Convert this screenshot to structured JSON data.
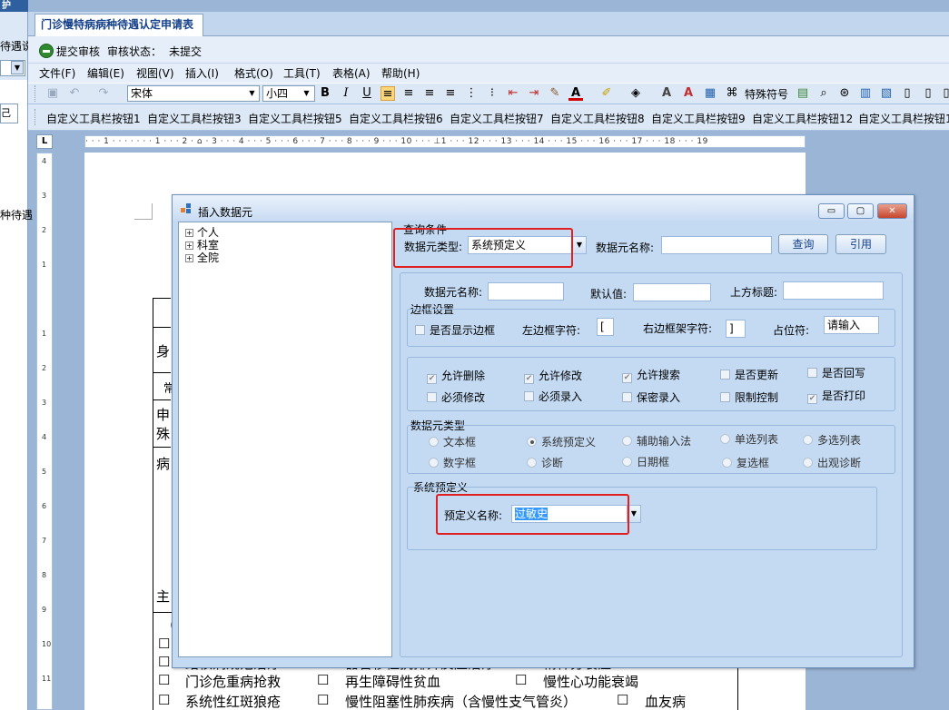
{
  "left_panel": {
    "tab_label": "护",
    "text1": "待遇说",
    "button_label": "己",
    "text2": "种待遇"
  },
  "document_tab": {
    "title": "门诊慢特病病种待遇认定申请表"
  },
  "status_bar": {
    "submit_label": "提交审核",
    "status_label": "审核状态：",
    "status_value": "未提交"
  },
  "menu": [
    "文件(F)",
    "编辑(E)",
    "视图(V)",
    "插入(I)",
    "格式(O)",
    "工具(T)",
    "表格(A)",
    "帮助(H)"
  ],
  "toolbar": {
    "font_name": "宋体",
    "font_size": "小四",
    "special_char_label": "特殊符号"
  },
  "custom_toolbar": [
    "自定义工具栏按钮1",
    "自定义工具栏按钮3",
    "自定义工具栏按钮5",
    "自定义工具栏按钮6",
    "自定义工具栏按钮7",
    "自定义工具栏按钮8",
    "自定义工具栏按钮9",
    "自定义工具栏按钮12",
    "自定义工具栏按钮1"
  ],
  "ruler": {
    "h_text": "· · · 1 · · ·   · · · · 1 · · · 2 · ⌂ · 3 · · · 4 · · · 5 · · · 6 · · · 7 · · · 8 · · · 9 · · · 10 · · · ⊥1 · · · 12 · · · 13 · · · 14 · · · 15 · · · 16 · · · 17 · · · 18 · · · 19",
    "v_numbers": [
      "4",
      "3",
      "2",
      "1",
      "1",
      "2",
      "3",
      "4",
      "5",
      "6",
      "7",
      "8",
      "9",
      "10",
      "11"
    ]
  },
  "document": {
    "fragments": [
      "身",
      "常",
      "申",
      "殊",
      "病",
      "主",
      "（"
    ],
    "rows": [
      [
        "☐",
        "结核病规范治疗",
        "☐",
        "器官移植抗排异反应治疗",
        "☐",
        "精神分裂症"
      ],
      [
        "☐",
        "门诊危重病抢救",
        "☐",
        "再生障碍性贫血",
        "☐",
        "慢性心功能衰竭"
      ],
      [
        "☐",
        "系统性红斑狼疮",
        "☐",
        "慢性阻塞性肺疾病（含慢性支气管炎）",
        "☐",
        "血友病"
      ]
    ]
  },
  "dialog": {
    "title": "插入数据元",
    "tree": [
      "个人",
      "科室",
      "全院"
    ],
    "query": {
      "group_title": "查询条件",
      "type_label": "数据元类型:",
      "type_value": "系统预定义",
      "name_label": "数据元名称:",
      "name_value": "",
      "search_button": "查询",
      "reference_button": "引用"
    },
    "props": {
      "name_label": "数据元名称:",
      "default_label": "默认值:",
      "top_title_label": "上方标题:",
      "border_group": "边框设置",
      "show_border": "是否显示边框",
      "left_border_label": "左边框字符:",
      "left_border_value": "[",
      "right_border_label": "右边框架字符:",
      "right_border_value": "]",
      "placeholder_label": "占位符:",
      "placeholder_value": "请输入"
    },
    "options": [
      {
        "label": "允许删除",
        "checked": true
      },
      {
        "label": "允许修改",
        "checked": true
      },
      {
        "label": "允许搜索",
        "checked": true
      },
      {
        "label": "是否更新",
        "checked": false
      },
      {
        "label": "是否回写",
        "checked": false
      },
      {
        "label": "必须修改",
        "checked": false
      },
      {
        "label": "必须录入",
        "checked": false
      },
      {
        "label": "保密录入",
        "checked": false
      },
      {
        "label": "限制控制",
        "checked": false
      },
      {
        "label": "是否打印",
        "checked": true
      }
    ],
    "type_group": {
      "title": "数据元类型",
      "options": [
        {
          "label": "文本框",
          "selected": false
        },
        {
          "label": "系统预定义",
          "selected": true
        },
        {
          "label": "辅助输入法",
          "selected": false
        },
        {
          "label": "单选列表",
          "selected": false
        },
        {
          "label": "多选列表",
          "selected": false
        },
        {
          "label": "数字框",
          "selected": false
        },
        {
          "label": "诊断",
          "selected": false
        },
        {
          "label": "日期框",
          "selected": false
        },
        {
          "label": "复选框",
          "selected": false
        },
        {
          "label": "出观诊断",
          "selected": false
        }
      ]
    },
    "predefined": {
      "group_title": "系统预定义",
      "name_label": "预定义名称:",
      "name_value": "过敏史"
    }
  },
  "colors": {
    "highlight": "#e02020",
    "selection": "#3399ff",
    "dialog_bg": "#c4daf3"
  }
}
